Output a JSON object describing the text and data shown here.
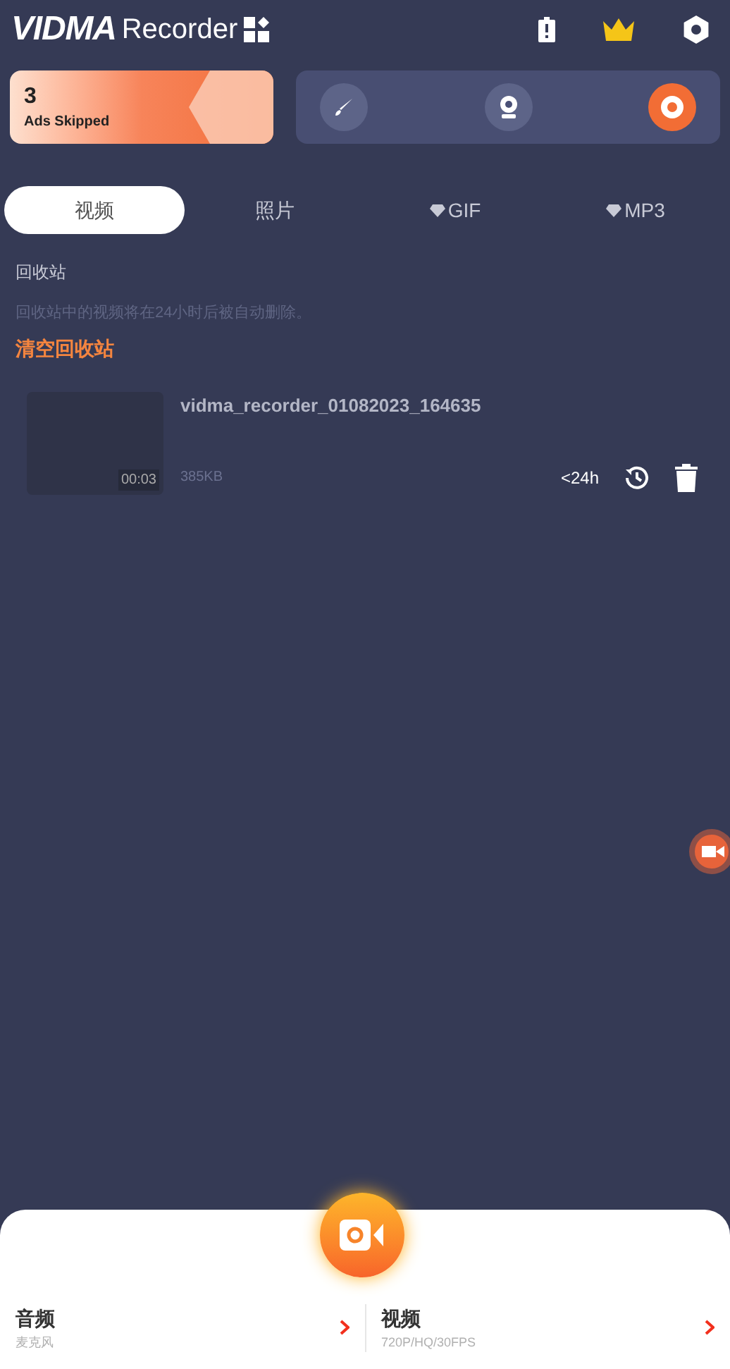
{
  "header": {
    "logo": "VIDMA",
    "title": "Recorder"
  },
  "ads_card": {
    "count": "3",
    "label": "Ads Skipped"
  },
  "tools": [
    {
      "kind": "brush",
      "active": false
    },
    {
      "kind": "camera",
      "active": false
    },
    {
      "kind": "record",
      "active": true
    }
  ],
  "tabs": [
    {
      "label": "视频",
      "selected": true,
      "premium": false
    },
    {
      "label": "照片",
      "selected": false,
      "premium": false
    },
    {
      "label": "GIF",
      "selected": false,
      "premium": true
    },
    {
      "label": "MP3",
      "selected": false,
      "premium": true
    }
  ],
  "recycle_bin": {
    "title": "回收站",
    "notice": "回收站中的视频将在24小时后被自动删除。",
    "clear_link": "清空回收站"
  },
  "items": [
    {
      "name": "vidma_recorder_01082023_164635",
      "duration": "00:03",
      "size": "385KB",
      "remaining": "<24h"
    }
  ],
  "bottom_sheet": {
    "options": [
      {
        "title": "音频",
        "subtitle": "麦克风"
      },
      {
        "title": "视频",
        "subtitle": "720P/HQ/30FPS"
      }
    ]
  }
}
